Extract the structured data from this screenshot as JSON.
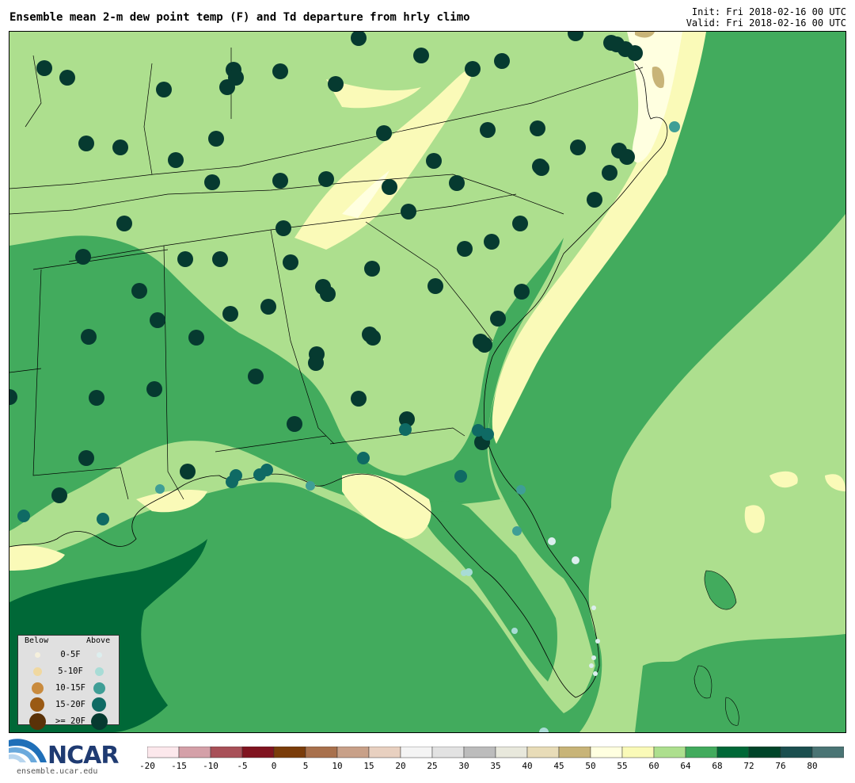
{
  "title": "Ensemble mean 2-m dew point temp (F) and Td departure from hrly climo",
  "init": "Init: Fri 2018-02-16 00 UTC",
  "valid": "Valid: Fri 2018-02-16 00 UTC",
  "legend": {
    "below_label": "Below",
    "above_label": "Above",
    "rows": [
      {
        "label": "0-5F",
        "below_color": "#f5f0dc",
        "above_color": "#dceeee"
      },
      {
        "label": "5-10F",
        "below_color": "#f0d8a0",
        "above_color": "#a8dcd6"
      },
      {
        "label": "10-15F",
        "below_color": "#c98b3e",
        "above_color": "#3f9e96"
      },
      {
        "label": "15-20F",
        "below_color": "#9a5a14",
        "above_color": "#0f6a64"
      },
      {
        "label": ">= 20F",
        "below_color": "#5a3208",
        "above_color": "#063a30"
      }
    ]
  },
  "colorbar": {
    "ticks": [
      "-20",
      "-15",
      "-10",
      "-5",
      "0",
      "5",
      "10",
      "15",
      "20",
      "25",
      "30",
      "35",
      "40",
      "45",
      "50",
      "55",
      "60",
      "64",
      "68",
      "72",
      "76",
      "80"
    ],
    "colors": [
      "#fce8ec",
      "#d4a0a8",
      "#a85058",
      "#801420",
      "#7a3c0a",
      "#a8704c",
      "#c8a088",
      "#e8d0c0",
      "#f4f4f4",
      "#e2e2e2",
      "#bcbcbc",
      "#e8e8dc",
      "#e8dcb8",
      "#c8b478",
      "#ffffe0",
      "#fafab8",
      "#addf8e",
      "#42ab5d",
      "#006837",
      "#004529",
      "#1b4f4f",
      "#4a7474"
    ]
  },
  "map_colors": {
    "gulf_atlantic": "#42ab5d",
    "land_light": "#addf8e",
    "pale_yellow": "#fafab8",
    "cream": "#ffffe0",
    "dark_green": "#006837",
    "tan": "#c8b478"
  },
  "logo": {
    "text": "NCAR",
    "url": "ensemble.ucar.edu",
    "icon": "ncar-swoosh-logo"
  }
}
